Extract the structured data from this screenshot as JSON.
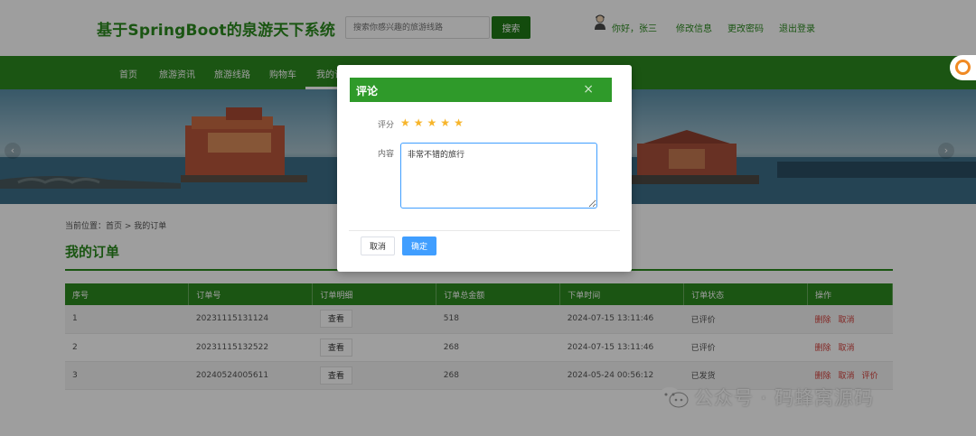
{
  "header": {
    "site_title": "基于SpringBoot的泉游天下系统",
    "search_placeholder": "搜索你感兴趣的旅游线路",
    "search_button": "搜索",
    "greeting": "你好，张三",
    "links": [
      "修改信息",
      "更改密码",
      "退出登录"
    ]
  },
  "nav": {
    "items": [
      "首页",
      "旅游资讯",
      "旅游线路",
      "购物车",
      "我的订单"
    ],
    "active_index": 4
  },
  "breadcrumb": "当前位置：首页 > 我的订单",
  "page_heading": "我的订单",
  "table": {
    "columns": [
      "序号",
      "订单号",
      "订单明细",
      "订单总金额",
      "下单时间",
      "订单状态",
      "操作"
    ],
    "view_label": "查看",
    "rows": [
      {
        "no": "1",
        "order_id": "20231115131124",
        "amount": "518",
        "time": "2024-07-15 13:11:46",
        "status": "已评价",
        "actions": [
          "删除",
          "取消"
        ]
      },
      {
        "no": "2",
        "order_id": "20231115132522",
        "amount": "268",
        "time": "2024-07-15 13:11:46",
        "status": "已评价",
        "actions": [
          "删除",
          "取消"
        ]
      },
      {
        "no": "3",
        "order_id": "20240524005611",
        "amount": "268",
        "time": "2024-05-24 00:56:12",
        "status": "已发货",
        "actions": [
          "删除",
          "取消",
          "评价"
        ]
      }
    ]
  },
  "modal": {
    "title": "评论",
    "close_glyph": "×",
    "rating_label": "评分",
    "rating_value": 5,
    "rating_max": 5,
    "content_label": "内容",
    "content_value": "非常不错的旅行",
    "cancel_label": "取消",
    "confirm_label": "确定"
  },
  "watermark": "公众号 · 码蜂窝源码",
  "colors": {
    "brand_green": "#2c8a1f",
    "modal_header": "#2f9a2a",
    "primary_blue": "#409eff",
    "star": "#f7b52b",
    "danger": "#d43f3a"
  },
  "icons": {
    "avatar": "user-avatar-icon",
    "star": "star-icon",
    "close": "close-icon",
    "prev": "chevron-left-icon",
    "next": "chevron-right-icon",
    "float": "orange-ring-icon",
    "wechat": "wechat-icon"
  }
}
